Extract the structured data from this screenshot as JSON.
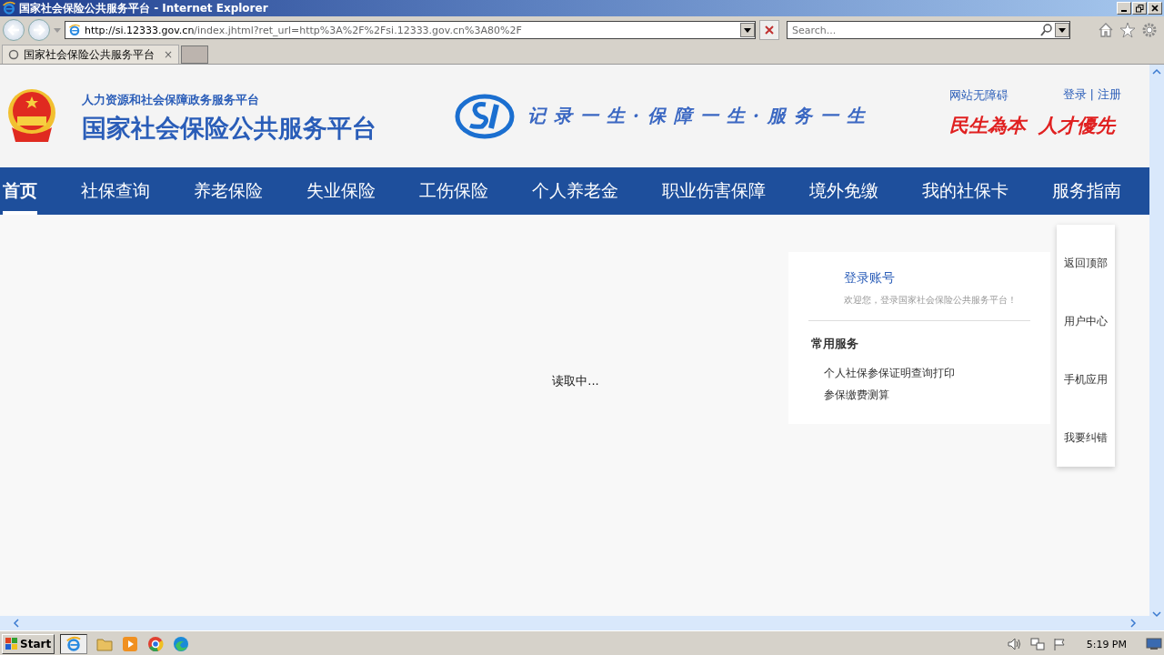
{
  "window": {
    "title": "国家社会保险公共服务平台 - Internet Explorer"
  },
  "address_bar": {
    "url_host": "http://si.12333.gov.cn",
    "url_path": "/index.jhtml?ret_url=http%3A%2F%2Fsi.12333.gov.cn%3A80%2F"
  },
  "search": {
    "placeholder": "Search..."
  },
  "tabs": [
    {
      "label": "国家社会保险公共服务平台",
      "close": "×",
      "selected": true
    }
  ],
  "header": {
    "subtitle": "人力资源和社会保障政务服务平台",
    "title": "国家社会保险公共服务平台",
    "slogan": "记录一生·保障一生·服务一生",
    "accessibility": "网站无障碍",
    "login": "登录",
    "separator": "|",
    "register": "注册",
    "motto": [
      "民生為本",
      "人才優先"
    ]
  },
  "nav": [
    {
      "label": "首页",
      "selected": true
    },
    {
      "label": "社保查询",
      "selected": false
    },
    {
      "label": "养老保险",
      "selected": false
    },
    {
      "label": "失业保险",
      "selected": false
    },
    {
      "label": "工伤保险",
      "selected": false
    },
    {
      "label": "个人养老金",
      "selected": false
    },
    {
      "label": "职业伤害保障",
      "selected": false
    },
    {
      "label": "境外免缴",
      "selected": false
    },
    {
      "label": "我的社保卡",
      "selected": false
    },
    {
      "label": "服务指南",
      "selected": false
    }
  ],
  "loading": "读取中...",
  "login_card": {
    "title": "登录账号",
    "welcome": "欢迎您，登录国家社会保险公共服务平台！",
    "section": "常用服务",
    "services": [
      "个人社保参保证明查询打印",
      "参保缴费测算"
    ]
  },
  "side_tools": [
    "返回顶部",
    "用户中心",
    "手机应用",
    "我要纠错"
  ],
  "taskbar": {
    "start": "Start",
    "time": "5:19 PM"
  }
}
